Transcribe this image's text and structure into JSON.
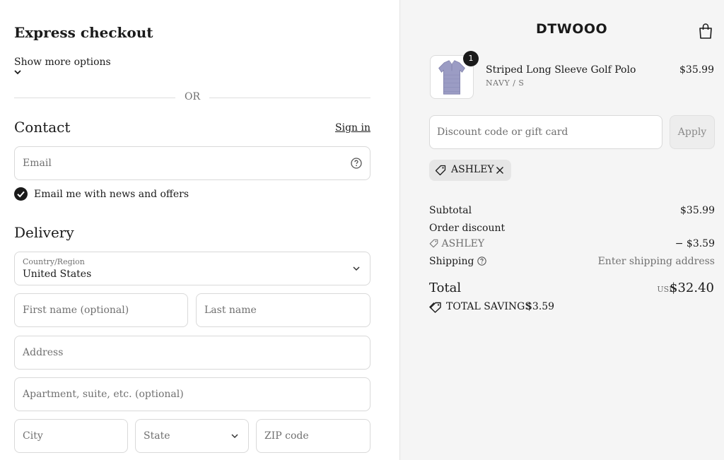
{
  "express": {
    "heading": "Express checkout",
    "show_more": "Show more options",
    "or_text": "OR"
  },
  "contact": {
    "heading": "Contact",
    "sign_in": "Sign in",
    "email_placeholder": "Email",
    "newsletter_label": "Email me with news and offers",
    "newsletter_checked": true
  },
  "delivery": {
    "heading": "Delivery",
    "country_label": "Country/Region",
    "country_value": "United States",
    "first_name_placeholder": "First name (optional)",
    "last_name_placeholder": "Last name",
    "address_placeholder": "Address",
    "apartment_placeholder": "Apartment, suite, etc. (optional)",
    "city_placeholder": "City",
    "state_placeholder": "State",
    "zip_placeholder": "ZIP code"
  },
  "summary": {
    "logo": "DTWOOO",
    "product": {
      "name": "Striped Long Sleeve Golf Polo",
      "variant": "NAVY / S",
      "price": "$35.99",
      "quantity": "1"
    },
    "discount_placeholder": "Discount code or gift card",
    "apply_label": "Apply",
    "applied_code": "ASHLEY",
    "subtotal_label": "Subtotal",
    "subtotal_value": "$35.99",
    "order_discount_label": "Order discount",
    "discount_code": "ASHLEY",
    "discount_value": "− $3.59",
    "shipping_label": "Shipping",
    "shipping_value": "Enter shipping address",
    "total_label": "Total",
    "currency": "USD",
    "total_value": "$32.40",
    "savings_label": "TOTAL SAVINGS",
    "savings_value": "$3.59"
  },
  "colors": {
    "text": "#1a1a1a",
    "muted": "#707070",
    "border": "#d9d9d9",
    "summary_bg": "#f5f5f5"
  }
}
